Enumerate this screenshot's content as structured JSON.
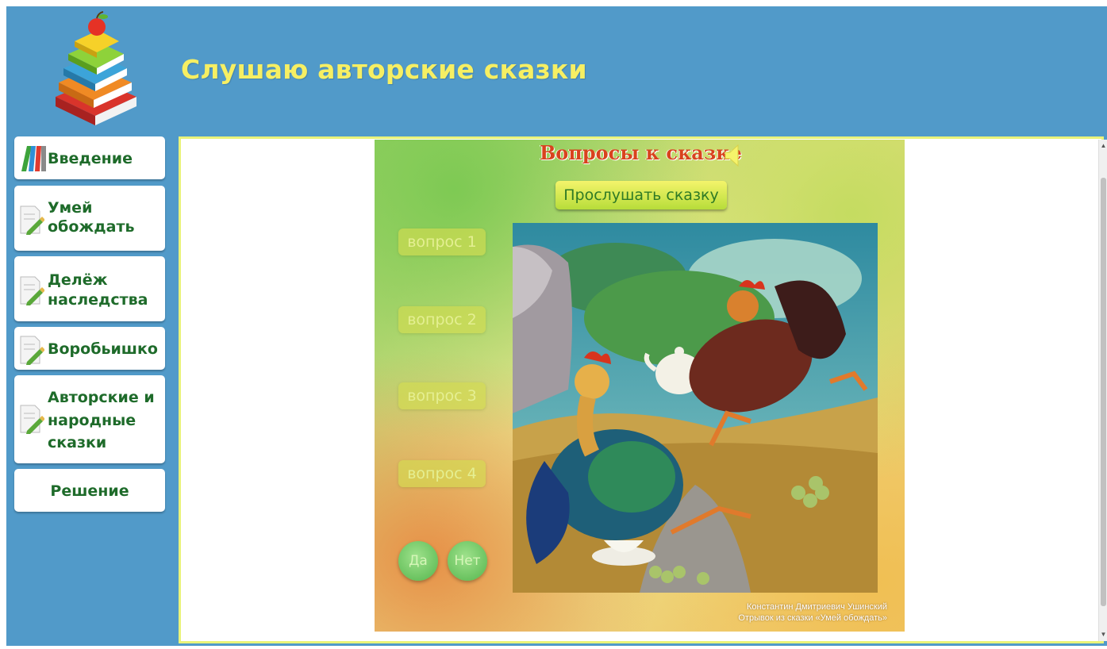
{
  "header": {
    "title": "Слушаю авторские сказки"
  },
  "sidebar": {
    "items": [
      {
        "lines": [
          "Введение"
        ]
      },
      {
        "lines": [
          "Умей",
          "обождать"
        ]
      },
      {
        "lines": [
          "Делёж",
          "наследства"
        ]
      },
      {
        "lines": [
          "Воробьишко"
        ]
      },
      {
        "lines": [
          "Авторские и",
          "народные",
          "сказки"
        ]
      },
      {
        "lines": [
          "Решение"
        ]
      }
    ]
  },
  "quiz": {
    "title": "Вопросы к сказке",
    "listen_label": "Прослушать сказку",
    "questions": [
      "вопрос 1",
      "вопрос 2",
      "вопрос 3",
      "вопрос 4"
    ],
    "yes_label": "Да",
    "no_label": "Нет",
    "credits": [
      "Константин Дмитриевич Ушинский",
      "Отрывок из сказки «Умей обождать»"
    ]
  },
  "colors": {
    "header_bg": "#519ac9",
    "title": "#f6ef63",
    "nav_text": "#1e6b2a",
    "quiz_title": "#d8431d"
  },
  "icons": {
    "logo": "books-apple-logo",
    "intro": "colored-books-icon",
    "doc": "document-pencil-icon",
    "speaker": "speaker-icon"
  }
}
